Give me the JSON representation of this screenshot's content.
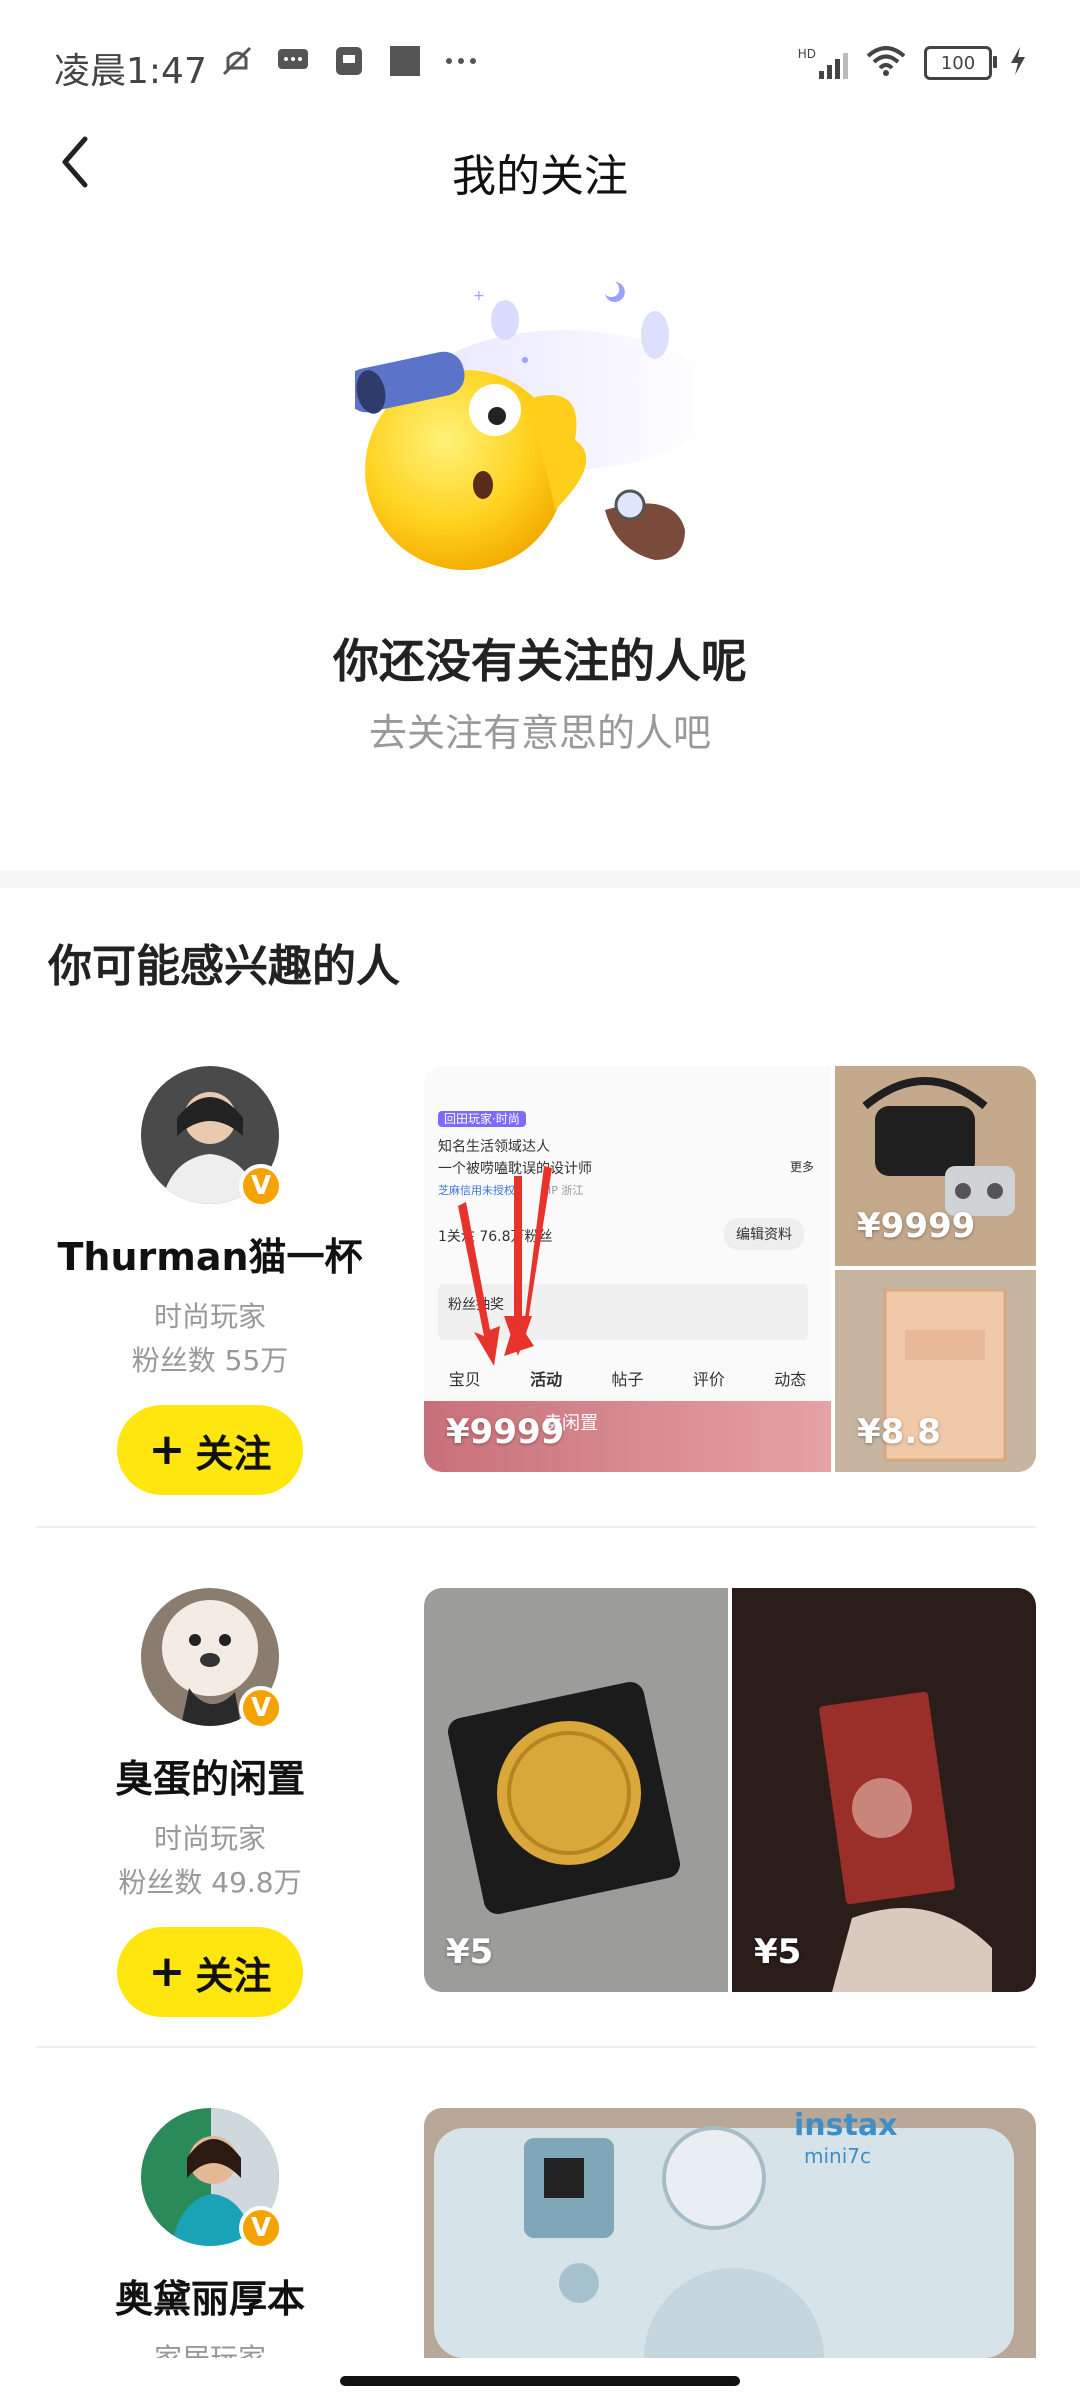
{
  "status_bar": {
    "time": "凌晨1:47",
    "network_label": "HD",
    "battery": "100"
  },
  "nav": {
    "title": "我的关注"
  },
  "empty_state": {
    "title": "你还没有关注的人呢",
    "subtitle": "去关注有意思的人吧"
  },
  "section": {
    "title": "你可能感兴趣的人"
  },
  "cards": [
    {
      "name": "Thurman猫一杯",
      "tag": "时尚玩家",
      "fans": "粉丝数 55万",
      "follow_label": "关注",
      "verified_label": "V",
      "prices": [
        "¥9999",
        "¥9999",
        "¥8.8"
      ],
      "mock": {
        "badge": "回田玩家·时尚",
        "line1": "知名生活领域达人",
        "line2": "一个被唠嗑耽误的设计师",
        "more": "更多",
        "credit": "芝麻信用未授权",
        "ip": "IP 浙江",
        "stats": "1关注  76.8万粉丝",
        "edit": "编辑资料",
        "lottery": "粉丝抽奖",
        "tabs": [
          "宝贝",
          "活动",
          "帖子",
          "评价",
          "动态"
        ],
        "banner": "卖闲置"
      }
    },
    {
      "name": "臭蛋的闲置",
      "tag": "时尚玩家",
      "fans": "粉丝数 49.8万",
      "follow_label": "关注",
      "verified_label": "V",
      "prices": [
        "¥5",
        "¥5"
      ]
    },
    {
      "name": "奥黛丽厚本",
      "tag": "家居玩家",
      "verified_label": "V",
      "photo_brand": "instax",
      "photo_model": "mini7c"
    }
  ],
  "colors": {
    "accent": "#ffe60f",
    "verified": "#f5a300",
    "muted_text": "#999999"
  }
}
